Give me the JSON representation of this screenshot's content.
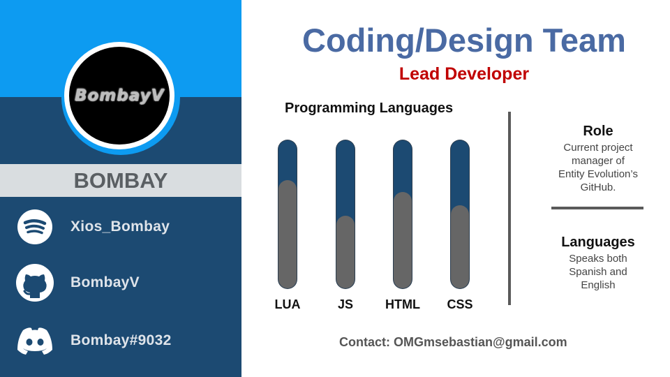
{
  "profile": {
    "avatar_text": "BombayV",
    "name": "BOMBAY"
  },
  "social": [
    {
      "icon": "spotify-icon",
      "label": "Xios_Bombay"
    },
    {
      "icon": "github-icon",
      "label": "BombayV"
    },
    {
      "icon": "discord-icon",
      "label": "Bombay#9032"
    }
  ],
  "header": {
    "title": "Coding/Design Team",
    "subtitle": "Lead Developer"
  },
  "colors": {
    "accent_blue": "#0d9bf1",
    "panel_navy": "#1c4a72",
    "title_blue": "#4a6aa3",
    "subtitle_red": "#c00000",
    "bar_gray": "#666666"
  },
  "chart_data": {
    "type": "bar",
    "title": "Programming Languages",
    "categories": [
      "LUA",
      "JS",
      "HTML",
      "CSS"
    ],
    "values": [
      73,
      49,
      65,
      56
    ],
    "ylim": [
      0,
      100
    ]
  },
  "info": {
    "role": {
      "heading": "Role",
      "lines": [
        "Current project",
        "manager of",
        "Entity Evolution’s",
        "GitHub."
      ]
    },
    "languages": {
      "heading": "Languages",
      "lines": [
        "Speaks both",
        "Spanish and",
        "English"
      ]
    }
  },
  "contact": "Contact: OMGmsebastian@gmail.com"
}
